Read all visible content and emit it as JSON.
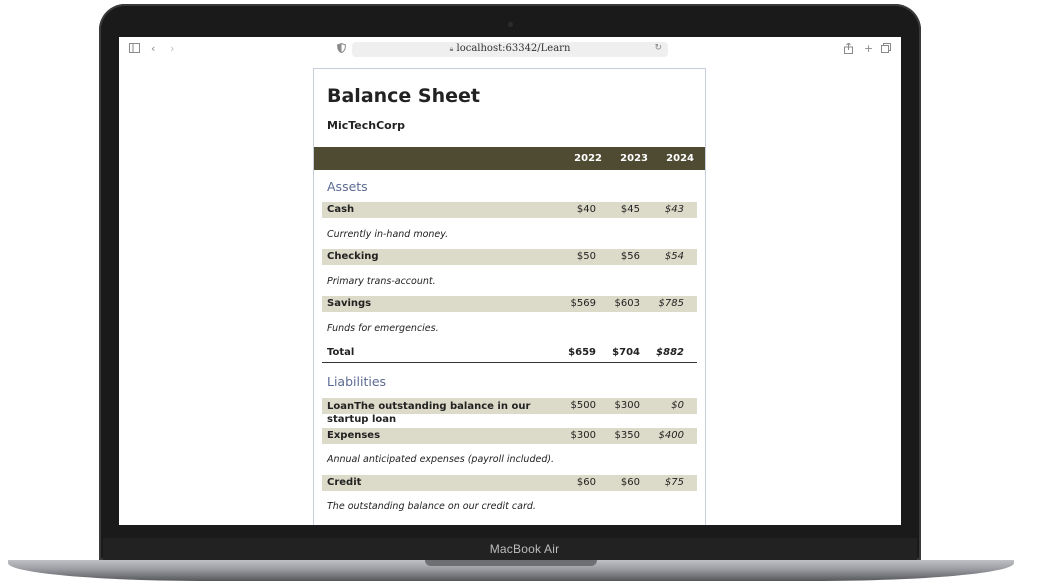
{
  "device": {
    "brand_label": "MacBook Air"
  },
  "browser": {
    "url": "localhost:63342/Learn",
    "icons": [
      "sidebar-icon",
      "back-icon",
      "forward-icon",
      "shield-icon",
      "lock-icon",
      "reload-icon",
      "share-icon",
      "new-tab-icon",
      "tabs-overview-icon"
    ]
  },
  "sheet": {
    "title": "Balance Sheet",
    "company": "MicTechCorp",
    "years": [
      "2022",
      "2023",
      "2024"
    ],
    "assets": {
      "heading": "Assets",
      "rows": [
        {
          "label": "Cash",
          "values": [
            "$40",
            "$45",
            "$43"
          ],
          "note": "Currently in-hand money."
        },
        {
          "label": "Checking",
          "values": [
            "$50",
            "$56",
            "$54"
          ],
          "note": "Primary trans-account."
        },
        {
          "label": "Savings",
          "values": [
            "$569",
            "$603",
            "$785"
          ],
          "note": "Funds for emergencies."
        }
      ],
      "total": {
        "label": "Total",
        "values": [
          "$659",
          "$704",
          "$882"
        ]
      }
    },
    "liabilities": {
      "heading": "Liabilities",
      "rows": [
        {
          "label": "LoanThe outstanding balance in our startup loan",
          "values": [
            "$500",
            "$300",
            "$0"
          ],
          "note": ""
        },
        {
          "label": "Expenses",
          "values": [
            "$300",
            "$350",
            "$400"
          ],
          "note": "Annual anticipated expenses (payroll included)."
        },
        {
          "label": "Credit",
          "values": [
            "$60",
            "$60",
            "$75"
          ],
          "note": "The outstanding balance on our credit card."
        }
      ]
    }
  },
  "colors": {
    "header_bar": "#4f4b32",
    "row_shade": "#dcdac8",
    "section_heading": "#5b6a92"
  }
}
